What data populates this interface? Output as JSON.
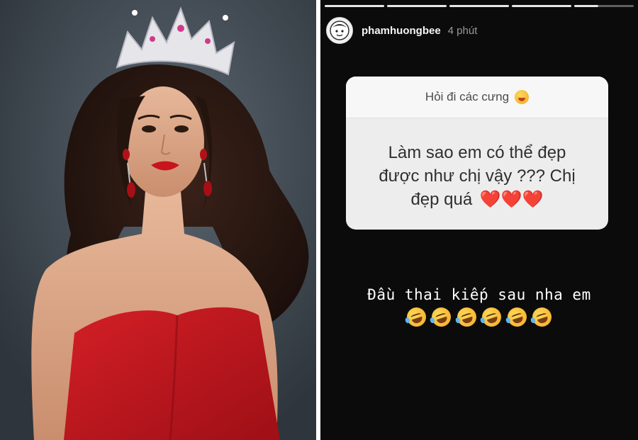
{
  "story": {
    "username": "phamhuongbee",
    "time": "4 phút",
    "question": {
      "prompt": "Hỏi đi các cưng",
      "prompt_emoji": "tongue-face-emoji",
      "line1": "Làm sao em có thể đẹp",
      "line2": "được như chị vậy ??? Chị",
      "line3": "đẹp quá",
      "heart_emojis": "❤️❤️❤️"
    },
    "answer": {
      "text": "Đầu thai kiếp sau nha em",
      "emoji_count": 6,
      "emoji_name": "rolling-on-floor-laughing-emoji"
    },
    "progress": {
      "segments": 5,
      "active": 5,
      "fraction": 0.4
    }
  },
  "photo": {
    "subject": "woman-in-red-dress-with-crown-icon"
  },
  "colors": {
    "story_bg": "#0b0b0b",
    "card_bg": "#ededed",
    "dress_red": "#c4171f",
    "photo_bg": "#3b444d"
  }
}
